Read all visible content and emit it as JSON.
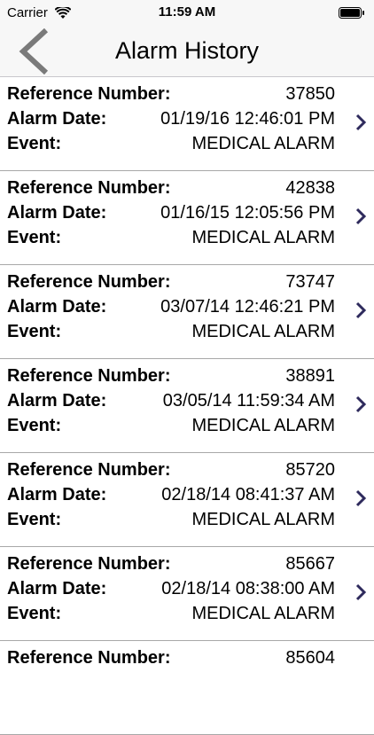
{
  "status_bar": {
    "carrier": "Carrier",
    "time": "11:59 AM"
  },
  "nav": {
    "title": "Alarm History",
    "back_icon": "chevron-left-icon"
  },
  "labels": {
    "reference": "Reference Number:",
    "date": "Alarm Date:",
    "event": "Event:"
  },
  "records": [
    {
      "reference": "37850",
      "date": "01/19/16 12:46:01 PM",
      "event": "MEDICAL ALARM"
    },
    {
      "reference": "42838",
      "date": "01/16/15 12:05:56 PM",
      "event": "MEDICAL ALARM"
    },
    {
      "reference": "73747",
      "date": "03/07/14 12:46:21 PM",
      "event": "MEDICAL ALARM"
    },
    {
      "reference": "38891",
      "date": "03/05/14 11:59:34 AM",
      "event": "MEDICAL ALARM"
    },
    {
      "reference": "85720",
      "date": "02/18/14 08:41:37 AM",
      "event": "MEDICAL ALARM"
    },
    {
      "reference": "85667",
      "date": "02/18/14 08:38:00 AM",
      "event": "MEDICAL ALARM"
    },
    {
      "reference": "85604",
      "date": "",
      "event": ""
    }
  ],
  "colors": {
    "chevron": "#2e2a5c",
    "back_arrow": "#7a7a7a",
    "separator": "#a8a8a8"
  }
}
